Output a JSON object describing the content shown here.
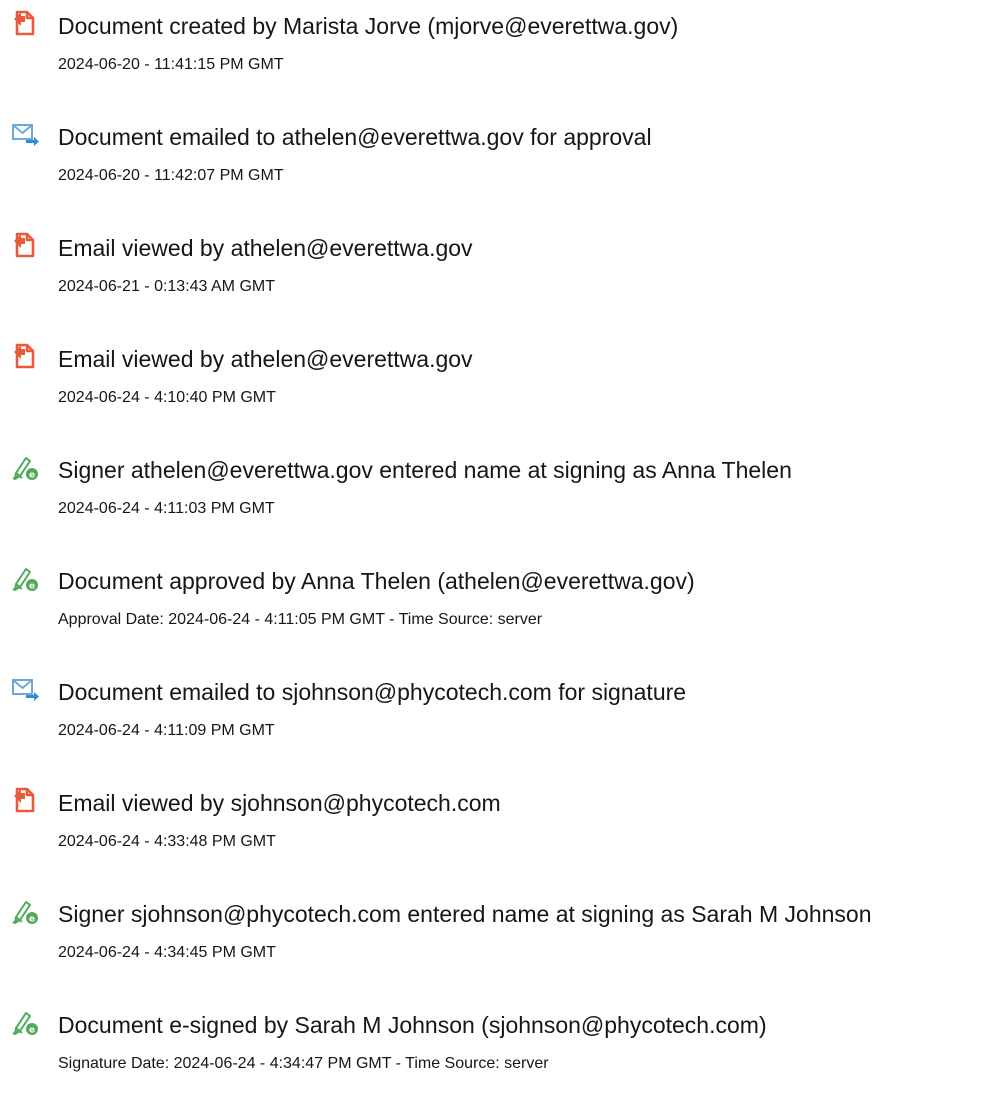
{
  "colors": {
    "document_icon": "#ea5a3a",
    "email_icon_envelope": "#6ea8d8",
    "email_icon_arrow": "#2f8fd6",
    "signature_icon": "#4faa5a",
    "text": "#161616"
  },
  "events": [
    {
      "icon": "document-icon",
      "title": "Document created by Marista Jorve (mjorve@everettwa.gov)",
      "detail": "2024-06-20 - 11:41:15 PM GMT"
    },
    {
      "icon": "email-sent-icon",
      "title": "Document emailed to athelen@everettwa.gov for approval",
      "detail": "2024-06-20 - 11:42:07 PM GMT"
    },
    {
      "icon": "document-icon",
      "title": "Email viewed by athelen@everettwa.gov",
      "detail": "2024-06-21 - 0:13:43 AM GMT"
    },
    {
      "icon": "document-icon",
      "title": "Email viewed by athelen@everettwa.gov",
      "detail": "2024-06-24 - 4:10:40 PM GMT"
    },
    {
      "icon": "signature-pen-icon",
      "title": "Signer athelen@everettwa.gov entered name at signing as Anna Thelen",
      "detail": "2024-06-24 - 4:11:03 PM GMT"
    },
    {
      "icon": "signature-pen-icon",
      "title": "Document approved by Anna Thelen (athelen@everettwa.gov)",
      "detail": "Approval Date: 2024-06-24 - 4:11:05 PM GMT - Time Source: server"
    },
    {
      "icon": "email-sent-icon",
      "title": "Document emailed to sjohnson@phycotech.com for signature",
      "detail": "2024-06-24 - 4:11:09 PM GMT"
    },
    {
      "icon": "document-icon",
      "title": "Email viewed by sjohnson@phycotech.com",
      "detail": "2024-06-24 - 4:33:48 PM GMT"
    },
    {
      "icon": "signature-pen-icon",
      "title": "Signer sjohnson@phycotech.com entered name at signing as Sarah M Johnson",
      "detail": "2024-06-24 - 4:34:45 PM GMT"
    },
    {
      "icon": "signature-pen-icon",
      "title": "Document e-signed by Sarah M Johnson (sjohnson@phycotech.com)",
      "detail": "Signature Date: 2024-06-24 - 4:34:47 PM GMT - Time Source: server"
    }
  ]
}
